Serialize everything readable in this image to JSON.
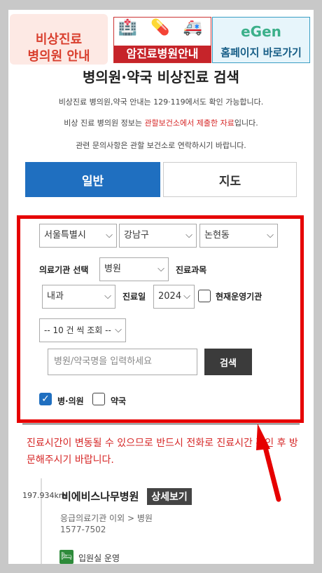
{
  "header": {
    "left_logo": [
      "비상진료",
      "병의원 안내"
    ],
    "mid_banner": {
      "label": "암진료병원안내",
      "icons": "🏥 💊 🚑"
    },
    "right_banner": {
      "brand": "eGen",
      "label": "홈페이지 바로가기"
    }
  },
  "page_title": "병의원·약국 비상진료 검색",
  "info": {
    "line1": "비상진료 병의원,약국 안내는 129·119에서도 확인 가능합니다.",
    "line2_pre": "비상 진료 병의원 정보는 ",
    "line2_hl": "관할보건소에서 제출한 자료",
    "line2_post": "입니다.",
    "line3": "관련 문의사항은 관할 보건소로 연락하시기 바랍니다."
  },
  "tabs": {
    "general": "일반",
    "map": "지도"
  },
  "form": {
    "region1": "서울특별시",
    "region2": "강남구",
    "region3": "논현동",
    "org_label": "의료기관 선택",
    "org_value": "병원",
    "dept_label": "진료과목",
    "dept_value": "내과",
    "date_label": "진료일",
    "date_value": "2024",
    "operating_label": "현재운영기관",
    "page_size": "-- 10 건 씩 조회 --",
    "search_placeholder": "병원/약국명을 입력하세요",
    "search_button": "검색",
    "check_hospital": "병·의원",
    "check_pharmacy": "약국",
    "check_hospital_checked": true,
    "check_pharmacy_checked": false
  },
  "notice": "진료시간이 변동될 수 있으므로 반드시 전화로 진료시간 확인 후 방문해주시기 바랍니다.",
  "results": [
    {
      "distance": "197.934km",
      "name": "비에비스나무병원",
      "detail_button": "상세보기",
      "category": "응급의료기관 이외 > 병원",
      "phone": "1577-7502",
      "bed_label": "입원실 운영"
    }
  ],
  "colors": {
    "primary": "#1f6fc0",
    "highlight_border": "#e60000",
    "notice": "#d62626"
  }
}
